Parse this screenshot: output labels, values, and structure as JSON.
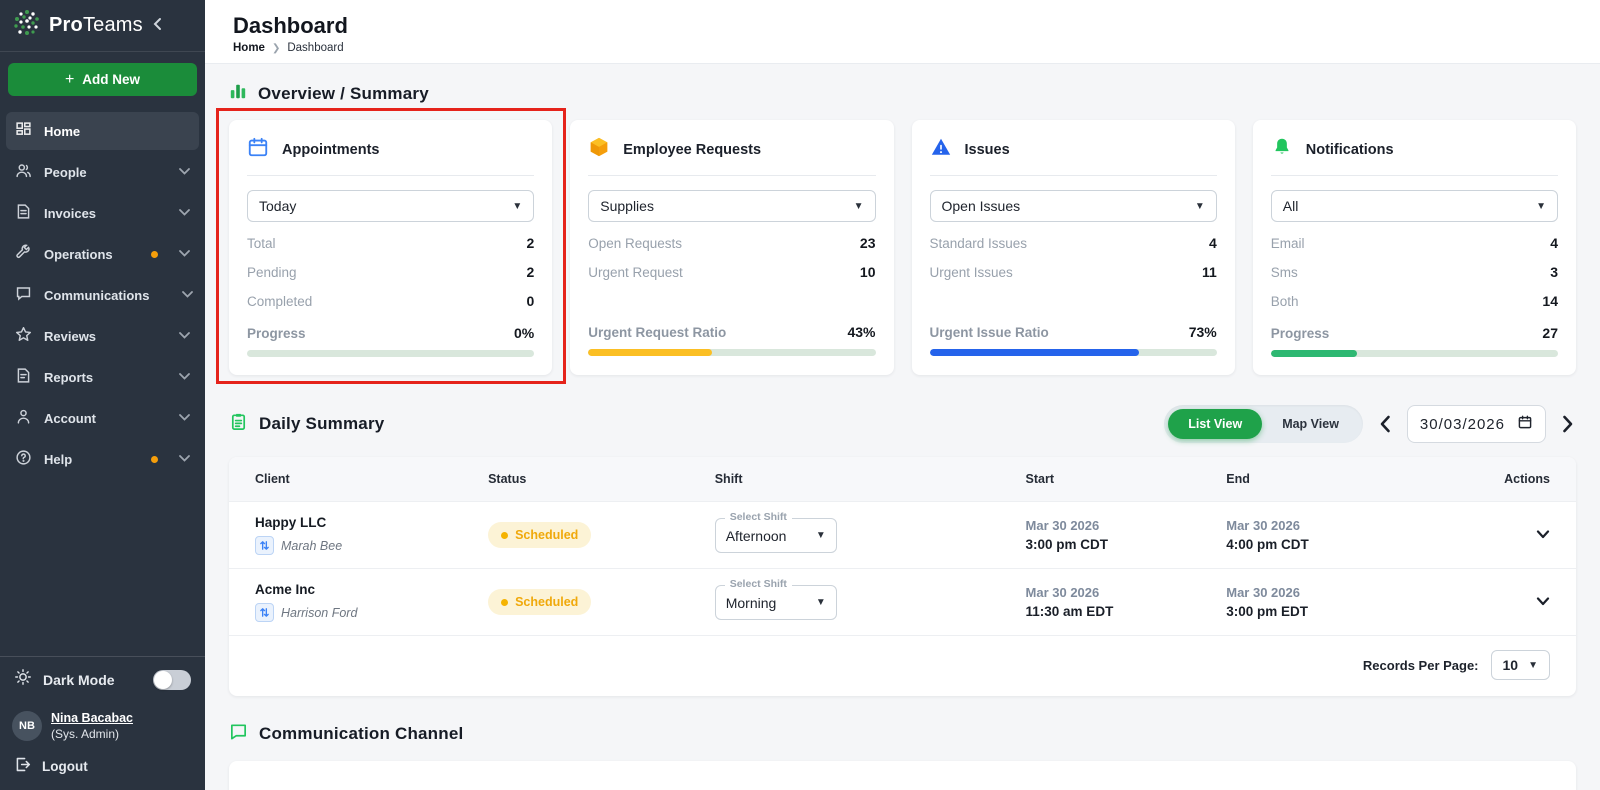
{
  "app": {
    "brand_bold": "Pro",
    "brand_light": "Teams",
    "collapse_glyph": "❮"
  },
  "colors": {
    "sidebar_bg": "#2a333f",
    "accent_green": "#1fa24a",
    "amber": "#fbbf24",
    "blue": "#2563eb",
    "orange_dot": "#f59e0b",
    "red_highlight": "#e5231b",
    "progress_track": "#d9e7dc",
    "badge_bg": "#fcf3d6",
    "badge_text": "#f0a90b"
  },
  "sidebar": {
    "add_new_label": "Add New",
    "items": [
      {
        "label": "Home",
        "icon": "grid-icon",
        "active": true,
        "dot": false
      },
      {
        "label": "People",
        "icon": "people-icon",
        "active": false,
        "dot": false
      },
      {
        "label": "Invoices",
        "icon": "invoice-icon",
        "active": false,
        "dot": false
      },
      {
        "label": "Operations",
        "icon": "wrench-icon",
        "active": false,
        "dot": true
      },
      {
        "label": "Communications",
        "icon": "chat-icon",
        "active": false,
        "dot": true
      },
      {
        "label": "Reviews",
        "icon": "star-icon",
        "active": false,
        "dot": false
      },
      {
        "label": "Reports",
        "icon": "report-icon",
        "active": false,
        "dot": false
      },
      {
        "label": "Account",
        "icon": "person-icon",
        "active": false,
        "dot": false
      },
      {
        "label": "Help",
        "icon": "help-icon",
        "active": false,
        "dot": true
      }
    ],
    "dark_mode_label": "Dark Mode",
    "user": {
      "initials": "NB",
      "name": "Nina Bacabac",
      "role": "(Sys. Admin)"
    },
    "logout_label": "Logout"
  },
  "header": {
    "title": "Dashboard",
    "breadcrumb_home": "Home",
    "breadcrumb_current": "Dashboard"
  },
  "overview": {
    "section_title": "Overview / Summary",
    "cards": [
      {
        "title": "Appointments",
        "icon": "calendar-icon",
        "filter": "Today",
        "rows": [
          {
            "label": "Total",
            "value": "2"
          },
          {
            "label": "Pending",
            "value": "2"
          },
          {
            "label": "Completed",
            "value": "0"
          }
        ],
        "progress_label": "Progress",
        "progress_value": "0%",
        "bar_width": "0%",
        "bar_color": "#2eb872"
      },
      {
        "title": "Employee Requests",
        "icon": "cube-icon",
        "filter": "Supplies",
        "rows": [
          {
            "label": "Open Requests",
            "value": "23"
          },
          {
            "label": "Urgent Request",
            "value": "10"
          }
        ],
        "progress_label": "Urgent Request Ratio",
        "progress_value": "43%",
        "bar_width": "43%",
        "bar_color": "#fbbf24"
      },
      {
        "title": "Issues",
        "icon": "warning-icon",
        "filter": "Open Issues",
        "rows": [
          {
            "label": "Standard Issues",
            "value": "4"
          },
          {
            "label": "Urgent Issues",
            "value": "11"
          }
        ],
        "progress_label": "Urgent Issue Ratio",
        "progress_value": "73%",
        "bar_width": "73%",
        "bar_color": "#2563eb"
      },
      {
        "title": "Notifications",
        "icon": "bell-icon",
        "filter": "All",
        "rows": [
          {
            "label": "Email",
            "value": "4"
          },
          {
            "label": "Sms",
            "value": "3"
          },
          {
            "label": "Both",
            "value": "14"
          }
        ],
        "progress_label": "Progress",
        "progress_value": "27",
        "bar_width": "30%",
        "bar_color": "#2eb872"
      }
    ]
  },
  "daily": {
    "section_title": "Daily Summary",
    "view_toggle": {
      "list_label": "List View",
      "map_label": "Map View",
      "selected": "List View"
    },
    "date_value": "30/03/2026",
    "table": {
      "headers": {
        "client": "Client",
        "status": "Status",
        "shift": "Shift",
        "start": "Start",
        "end": "End",
        "actions": "Actions"
      },
      "rows": [
        {
          "client": "Happy LLC",
          "contact": "Marah Bee",
          "status": "Scheduled",
          "shift_label": "Select Shift",
          "shift_value": "Afternoon",
          "start_date": "Mar 30 2026",
          "start_time": "3:00 pm CDT",
          "end_date": "Mar 30 2026",
          "end_time": "4:00 pm CDT"
        },
        {
          "client": "Acme Inc",
          "contact": "Harrison Ford",
          "status": "Scheduled",
          "shift_label": "Select Shift",
          "shift_value": "Morning",
          "start_date": "Mar 30 2026",
          "start_time": "11:30 am EDT",
          "end_date": "Mar 30 2026",
          "end_time": "3:00 pm EDT"
        }
      ],
      "records_per_page_label": "Records Per Page:",
      "records_per_page_value": "10"
    }
  },
  "communication": {
    "section_title": "Communication Channel"
  }
}
